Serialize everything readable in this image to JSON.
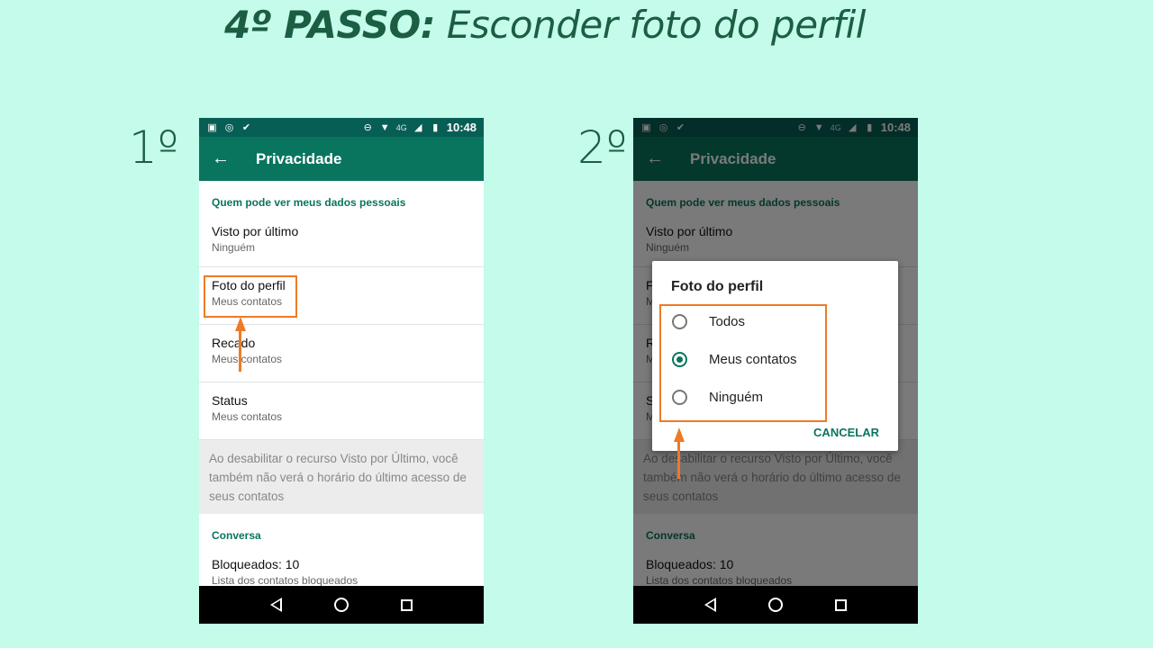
{
  "title": {
    "bold": "4º PASSO:",
    "rest": " Esconder foto do perfil"
  },
  "steps": [
    "1º",
    "2º"
  ],
  "status": {
    "carrier": "4G",
    "time": "10:48"
  },
  "app": {
    "title": "Privacidade",
    "section1": "Quem pode ver meus dados pessoais",
    "rows": [
      {
        "title": "Visto por último",
        "sub": "Ninguém"
      },
      {
        "title": "Foto do perfil",
        "sub": "Meus contatos"
      },
      {
        "title": "Recado",
        "sub": "Meus contatos"
      },
      {
        "title": "Status",
        "sub": "Meus contatos"
      }
    ],
    "note": "Ao desabilitar o recurso Visto por Último, você também não verá o horário do último acesso de seus contatos",
    "section2": "Conversa",
    "blocked": {
      "title": "Bloqueados: 10",
      "sub": "Lista dos contatos bloqueados"
    }
  },
  "dialog": {
    "title": "Foto do perfil",
    "options": [
      "Todos",
      "Meus contatos",
      "Ninguém"
    ],
    "selected": "Meus contatos",
    "cancel": "CANCELAR"
  },
  "colors": {
    "background": "#c4fbea",
    "accent": "#09755f",
    "highlight": "#ee7a26"
  }
}
